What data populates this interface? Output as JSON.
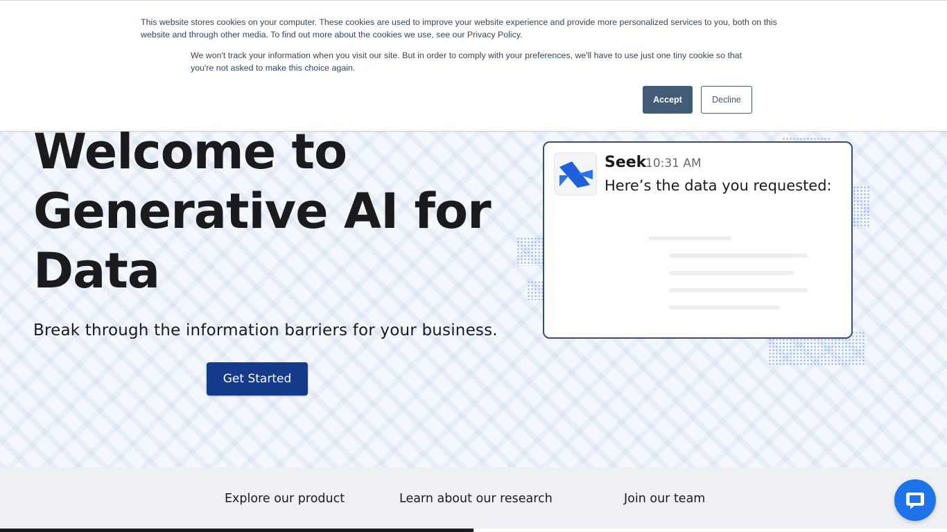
{
  "cookie_banner": {
    "text_primary": "This website stores cookies on your computer. These cookies are used to improve your website experience and provide more personalized services to you, both on this website and through other media. To find out more about the cookies we use, see our Privacy Policy.",
    "text_secondary": "We won't track your information when you visit our site. But in order to comply with your preferences, we'll have to use just one tiny cookie so that you're not asked to make this choice again.",
    "accept_label": "Accept",
    "decline_label": "Decline"
  },
  "hero": {
    "title": "Welcome to Generative AI for Data",
    "subtitle": "Break through the information barriers for your business.",
    "cta_label": "Get Started"
  },
  "chat_preview": {
    "sender": "Seek",
    "time": "10:31 AM",
    "message": "Here’s the data you requested:"
  },
  "bottom_nav": {
    "links": [
      "Explore our product",
      "Learn about our research",
      "Join our team"
    ]
  },
  "icons": {
    "avatar": "seek-logo-icon",
    "fab": "chat-bubble-icon"
  },
  "colors": {
    "primary": "#163a8a",
    "cookie_accent": "#425b76",
    "fab": "#1e73e8"
  }
}
